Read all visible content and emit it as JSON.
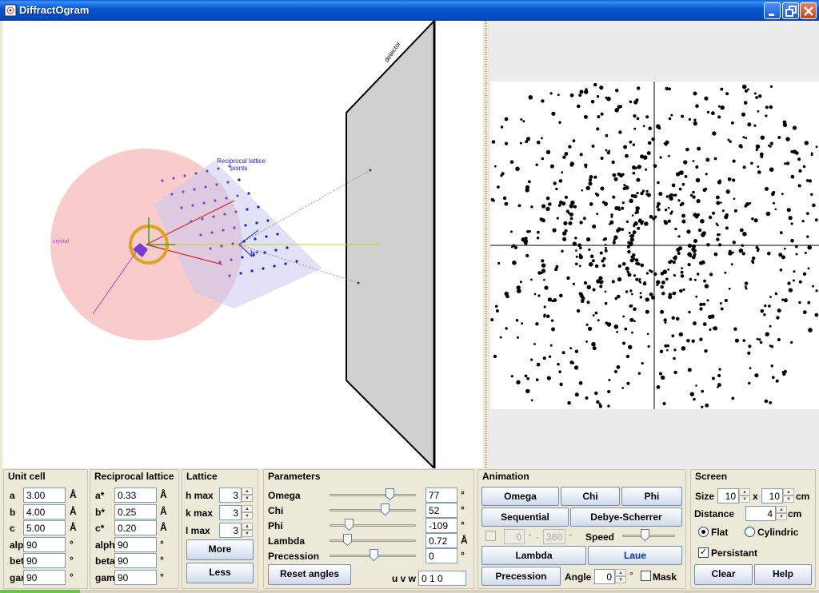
{
  "window": {
    "title": "DiffractOgram"
  },
  "scene": {
    "reciprocal_label": "Reciprocal lattice",
    "points_label": "points",
    "b_star_label": "b*"
  },
  "panels": {
    "unit_cell": {
      "title": "Unit cell",
      "rows": [
        {
          "label": "a",
          "value": "3.00",
          "unit": "Å"
        },
        {
          "label": "b",
          "value": "4.00",
          "unit": "Å"
        },
        {
          "label": "c",
          "value": "5.00",
          "unit": "Å"
        },
        {
          "label": "alpha",
          "value": "90",
          "unit": "°"
        },
        {
          "label": "beta",
          "value": "90",
          "unit": "°"
        },
        {
          "label": "gamma",
          "value": "90",
          "unit": "°"
        }
      ]
    },
    "reciprocal": {
      "title": "Reciprocal lattice",
      "rows": [
        {
          "label": "a*",
          "value": "0.33",
          "unit": "Å"
        },
        {
          "label": "b*",
          "value": "0.25",
          "unit": "Å"
        },
        {
          "label": "c*",
          "value": "0.20",
          "unit": "Å"
        },
        {
          "label": "alpha*",
          "value": "90",
          "unit": "°"
        },
        {
          "label": "beta*",
          "value": "90",
          "unit": "°"
        },
        {
          "label": "gamma*",
          "value": "90",
          "unit": "°"
        }
      ]
    },
    "lattice": {
      "title": "Lattice",
      "rows": [
        {
          "label": "h max",
          "value": "3"
        },
        {
          "label": "k max",
          "value": "3"
        },
        {
          "label": "l max",
          "value": "3"
        }
      ],
      "more_label": "More",
      "less_label": "Less"
    },
    "parameters": {
      "title": "Parameters",
      "rows": [
        {
          "label": "Omega",
          "value": "77",
          "unit": "°",
          "level": 0.72
        },
        {
          "label": "Chi",
          "value": "52",
          "unit": "°",
          "level": 0.66
        },
        {
          "label": "Phi",
          "value": "-109",
          "unit": "°",
          "level": 0.2
        },
        {
          "label": "Lambda",
          "value": "0.72",
          "unit": "Å",
          "level": 0.18
        },
        {
          "label": "Precession",
          "value": "0",
          "unit": "°",
          "level": 0.52
        }
      ],
      "reset_label": "Reset angles",
      "uvw_label": "u v w",
      "uvw_value": "0 1 0"
    },
    "animation": {
      "title": "Animation",
      "omega_label": "Omega",
      "chi_label": "Chi",
      "phi_label": "Phi",
      "sequential_label": "Sequential",
      "debye_label": "Debye-Scherrer",
      "range_from": "0",
      "range_to": "360",
      "range_unit": "°",
      "range_sep": "-",
      "speed_label": "Speed",
      "speed_level": 0.42,
      "lambda_label": "Lambda",
      "laue_label": "Laue",
      "precession_label": "Precession",
      "angle_label": "Angle",
      "angle_value": "0",
      "angle_unit": "°",
      "mask_label": "Mask"
    },
    "screen": {
      "title": "Screen",
      "size_label": "Size",
      "size_w": "10",
      "size_x": "x",
      "size_h": "10",
      "size_unit": "cm",
      "distance_label": "Distance",
      "distance_value": "4",
      "distance_unit": "cm",
      "flat_label": "Flat",
      "cylindric_label": "Cylindric",
      "persistant_label": "Persistant",
      "clear_label": "Clear",
      "help_label": "Help"
    }
  },
  "colors": {
    "ewald_sphere": "#f9c9c9",
    "lattice_points": "#1a1ad0",
    "beam": "#d4d400"
  }
}
